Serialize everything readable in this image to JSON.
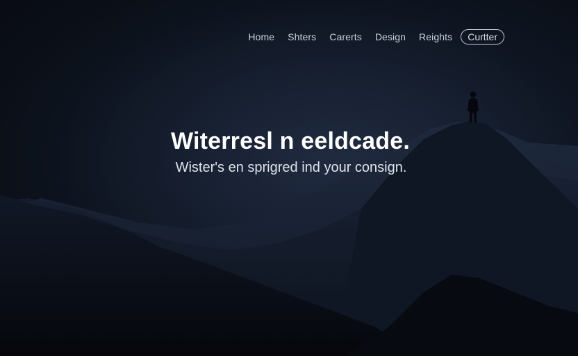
{
  "nav": {
    "links": [
      "Home",
      "Shters",
      "Carerts",
      "Design",
      "Reights"
    ],
    "cta_label": "Curtter"
  },
  "hero": {
    "title": "Witerresl n eeldcade.",
    "subtitle": "Wister's en sprigred ind your consign."
  },
  "colors": {
    "background": "#0b0f18",
    "text": "#ffffff",
    "nav_text": "#c9d0dc"
  }
}
